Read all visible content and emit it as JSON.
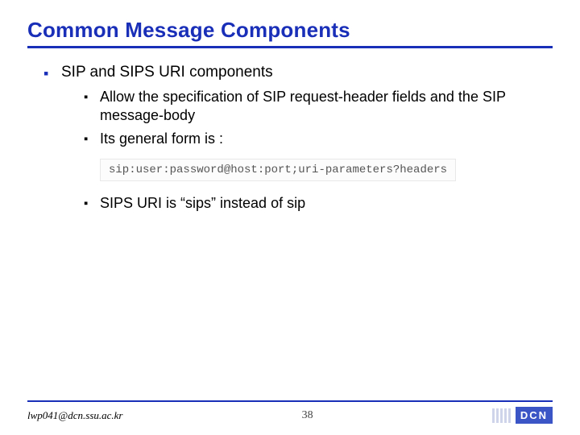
{
  "title": "Common Message Components",
  "bullets": {
    "item1": "SIP and SIPS URI components",
    "sub1": "Allow the specification of SIP request-header fields and the SIP message-body",
    "sub2": "Its general form is :",
    "code": "sip:user:password@host:port;uri-parameters?headers",
    "sub3": "SIPS URI is “sips” instead of sip"
  },
  "footer": {
    "email": "lwp041@dcn.ssu.ac.kr",
    "page": "38",
    "logo": "DCN"
  }
}
